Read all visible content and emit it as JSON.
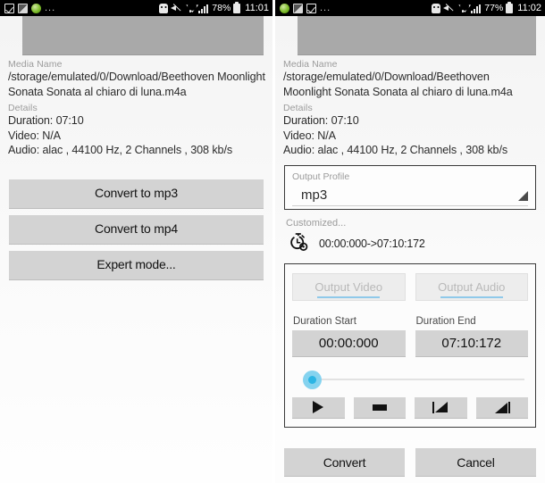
{
  "left": {
    "statusbar": {
      "icons_left": [
        "checkbox-icon",
        "photo-icon",
        "green-circle-icon"
      ],
      "overflow": "...",
      "icons_right": [
        "skull-icon",
        "mute-icon",
        "wifi-icon",
        "signal-icon"
      ],
      "battery_percent": "78%",
      "clock": "11:01"
    },
    "media_name_label": "Media Name",
    "media_path": "/storage/emulated/0/Download/Beethoven Moonlight Sonata Sonata al chiaro di luna.m4a",
    "details_label": "Details",
    "details": [
      "Duration: 07:10",
      "Video: N/A",
      "Audio: alac , 44100 Hz, 2 Channels , 308 kb/s"
    ],
    "actions": [
      {
        "label": "Convert to mp3",
        "name": "convert-to-mp3-button"
      },
      {
        "label": "Convert to mp4",
        "name": "convert-to-mp4-button"
      },
      {
        "label": "Expert mode...",
        "name": "expert-mode-button"
      }
    ]
  },
  "right": {
    "statusbar": {
      "icons_left": [
        "green-circle-icon",
        "photo-icon",
        "checkbox-icon"
      ],
      "overflow": "...",
      "icons_right": [
        "skull-icon",
        "mute-icon",
        "wifi-icon",
        "signal-icon"
      ],
      "battery_percent": "77%",
      "clock": "11:02"
    },
    "media_name_label": "Media Name",
    "media_path": "/storage/emulated/0/Download/Beethoven Moonlight Sonata Sonata al chiaro di luna.m4a",
    "details_label": "Details",
    "details": [
      "Duration: 07:10",
      "Video: N/A",
      "Audio: alac , 44100 Hz, 2 Channels , 308 kb/s"
    ],
    "output_profile": {
      "label": "Output Profile",
      "value": "mp3",
      "dropdown_icon": "triangle-down-icon"
    },
    "customized_label": "Customized...",
    "trim": {
      "icon": "stopwatch-icon",
      "range_text": "00:00:000->07:10:172"
    },
    "tabs": [
      {
        "label": "Output Video",
        "name": "tab-output-video"
      },
      {
        "label": "Output Audio",
        "name": "tab-output-audio"
      }
    ],
    "duration": {
      "start_label": "Duration Start",
      "end_label": "Duration End",
      "start_value": "00:00:000",
      "end_value": "07:10:172"
    },
    "slider": {
      "name": "seek-slider",
      "position_percent": 0
    },
    "transport": [
      {
        "name": "play-button",
        "icon": "play-icon"
      },
      {
        "name": "stop-button",
        "icon": "stop-icon"
      },
      {
        "name": "set-start-marker-button",
        "icon": "marker-start-icon"
      },
      {
        "name": "set-end-marker-button",
        "icon": "marker-end-icon"
      }
    ],
    "footer": {
      "convert_label": "Convert",
      "cancel_label": "Cancel"
    }
  },
  "colors": {
    "statusbar_bg": "#000000",
    "button_bg": "#d3d3d3",
    "banner_bg": "#a9a9a9",
    "accent_blue": "#2cb5e4",
    "accent_blue_light": "#85d3ef",
    "muted_text": "#9b9b9b"
  }
}
